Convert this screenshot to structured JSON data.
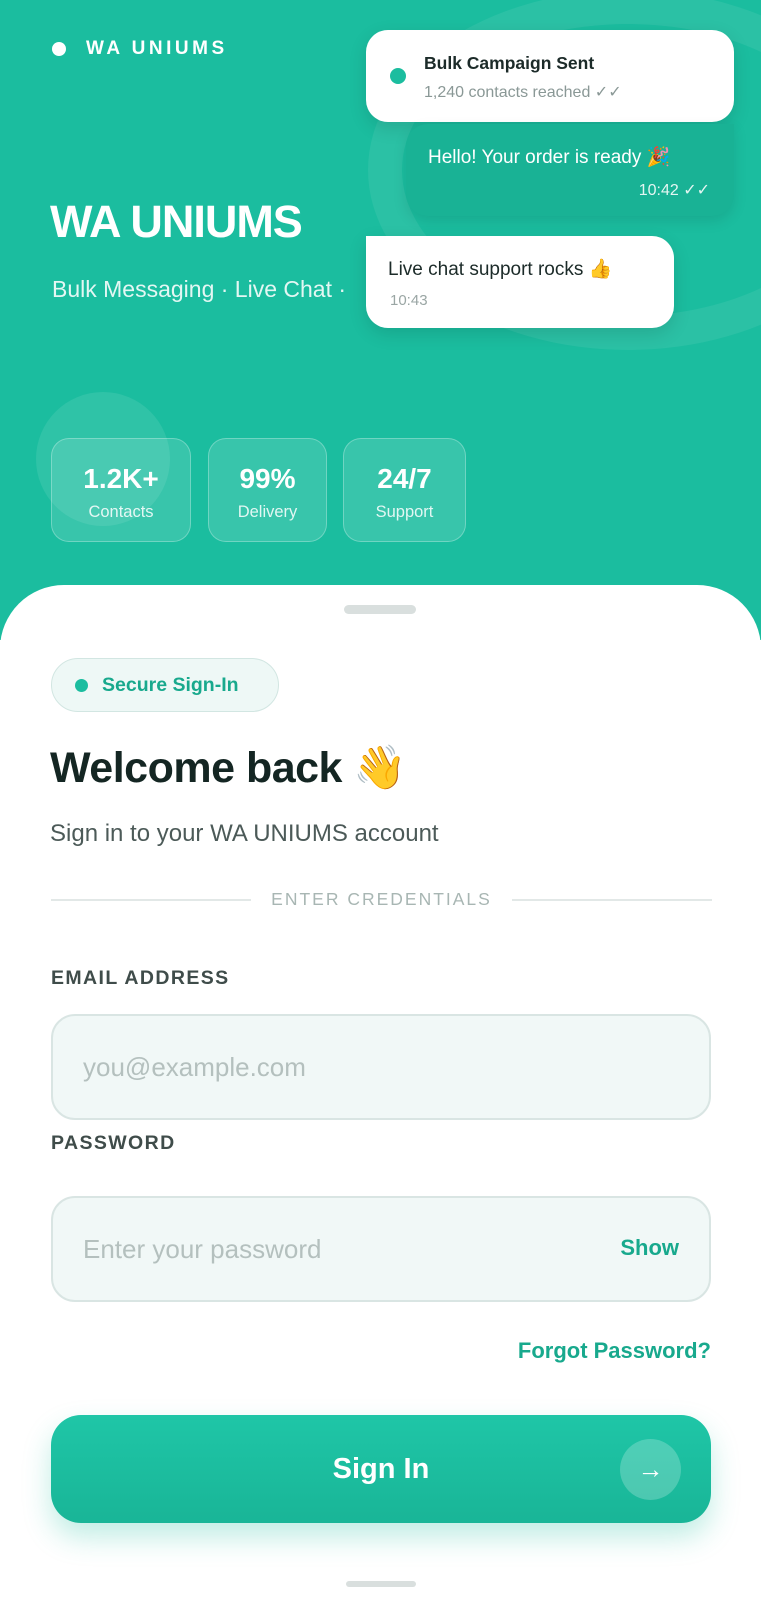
{
  "brand": {
    "label": "WA UNIUMS"
  },
  "hero": {
    "title": "WA UNIUMS",
    "subtitle": "Bulk Messaging · Live Chat ·"
  },
  "bubbles": {
    "campaign": {
      "title": "Bulk Campaign Sent",
      "subtitle": "1,240 contacts reached ✓✓"
    },
    "order": {
      "text": "Hello! Your order is ready 🎉",
      "time": "10:42 ✓✓"
    },
    "support": {
      "text": "Live chat support rocks 👍",
      "time": "10:43"
    }
  },
  "stats": [
    {
      "value": "1.2K+",
      "label": "Contacts"
    },
    {
      "value": "99%",
      "label": "Delivery"
    },
    {
      "value": "24/7",
      "label": "Support"
    }
  ],
  "badge": {
    "label": "Secure Sign-In"
  },
  "welcome": {
    "title": "Welcome back 👋",
    "subtitle": "Sign in to your WA UNIUMS account"
  },
  "divider": {
    "label": "ENTER CREDENTIALS"
  },
  "form": {
    "email_label": "EMAIL ADDRESS",
    "email_placeholder": "you@example.com",
    "email_value": "",
    "password_label": "PASSWORD",
    "password_placeholder": "Enter your password",
    "password_value": "",
    "show_label": "Show",
    "forgot_label": "Forgot Password?",
    "submit_label": "Sign In",
    "submit_icon": "→"
  },
  "colors": {
    "primary": "#1bbd9f",
    "primary_text": "#18a98d",
    "heading": "#142623"
  }
}
